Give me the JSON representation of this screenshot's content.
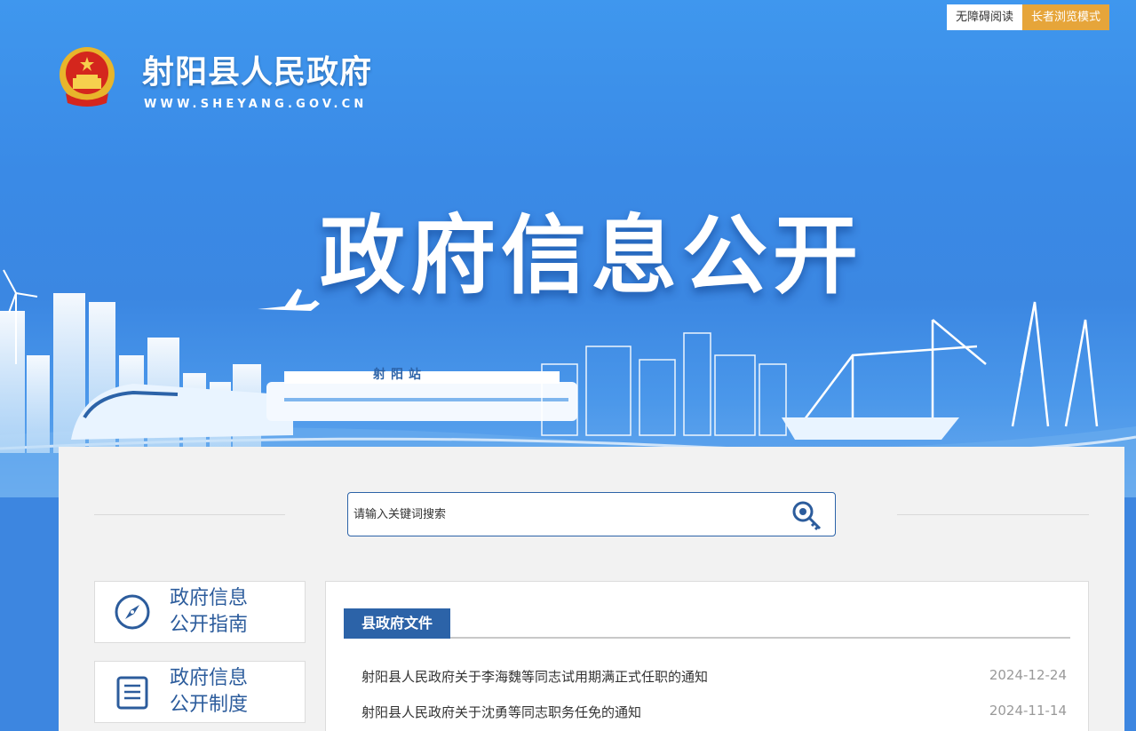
{
  "header": {
    "accessibility_link": "无障碍阅读",
    "elder_mode_link": "长者浏览模式",
    "site_title": "射阳县人民政府",
    "site_url": "WWW.SHEYANG.GOV.CN",
    "hero_title": "政府信息公开",
    "station_label": "射阳站"
  },
  "search": {
    "placeholder": "请输入关键词搜索",
    "icon": "search-key-icon"
  },
  "sidebar": {
    "items": [
      {
        "line1": "政府信息",
        "line2": "公开指南",
        "icon": "compass-icon"
      },
      {
        "line1": "政府信息",
        "line2": "公开制度",
        "icon": "document-list-icon"
      }
    ]
  },
  "panel": {
    "tab_label": "县政府文件",
    "items": [
      {
        "title": "射阳县人民政府关于李海魏等同志试用期满正式任职的通知",
        "date": "2024-12-24"
      },
      {
        "title": "射阳县人民政府关于沈勇等同志职务任免的通知",
        "date": "2024-11-14"
      }
    ]
  },
  "colors": {
    "brand_blue": "#2c63a8",
    "banner_blue": "#3a8ae6",
    "elder_orange": "#e6a53a"
  }
}
